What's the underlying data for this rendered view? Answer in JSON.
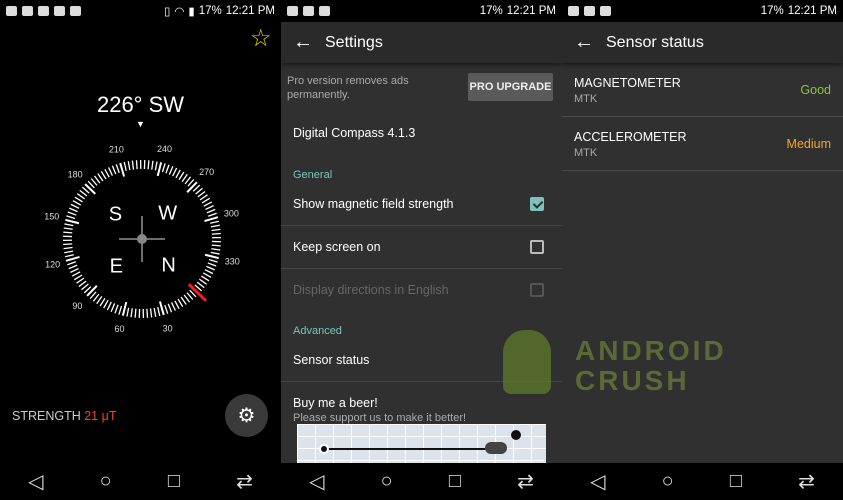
{
  "status_bar": {
    "battery": "17%",
    "time": "12:21 PM"
  },
  "compass": {
    "heading": "226° SW",
    "heading_degrees": 226,
    "dial_labels": [
      "30",
      "60",
      "90",
      "120",
      "150",
      "180",
      "210",
      "240",
      "270",
      "300",
      "330"
    ],
    "cardinals": {
      "N": "N",
      "E": "E",
      "S": "S",
      "W": "W"
    },
    "strength_label": "STRENGTH",
    "strength_value": "21 μT",
    "accent": "#ff1a1a",
    "star_color": "#f5d90a"
  },
  "settings": {
    "title": "Settings",
    "pro_text": "Pro version removes ads permanently.",
    "pro_button": "PRO UPGRADE",
    "version": "Digital Compass 4.1.3",
    "general_header": "General",
    "items": [
      {
        "label": "Show magnetic field strength",
        "checked": true,
        "enabled": true
      },
      {
        "label": "Keep screen on",
        "checked": false,
        "enabled": true
      },
      {
        "label": "Display directions in English",
        "checked": false,
        "enabled": false
      }
    ],
    "advanced_header": "Advanced",
    "sensor_status": "Sensor status",
    "beer_title": "Buy me a beer!",
    "beer_subtitle": "Please support us to make it better!",
    "accent": "#7cc4bb"
  },
  "sensor": {
    "title": "Sensor status",
    "rows": [
      {
        "name": "MAGNETOMETER",
        "vendor": "MTK",
        "status": "Good",
        "color": "#8bc34a"
      },
      {
        "name": "ACCELEROMETER",
        "vendor": "MTK",
        "status": "Medium",
        "color": "#f5a623"
      }
    ]
  },
  "watermark": "ANDROID CRUSH"
}
